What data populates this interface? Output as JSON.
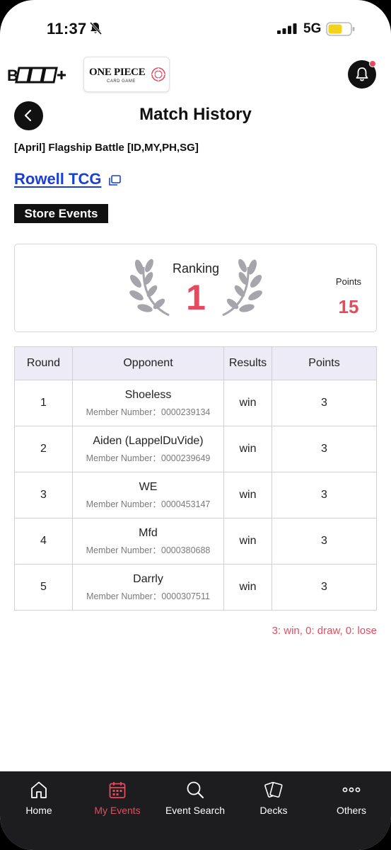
{
  "status_bar": {
    "time": "11:37",
    "network": "5G",
    "icons": [
      "bell-slash-icon",
      "signal-icon",
      "battery-icon"
    ]
  },
  "header": {
    "brand_logo_text": "B TCG+",
    "game_logo_title": "ONE PIECE",
    "game_logo_subtitle": "CARD GAME",
    "icons": [
      "notification-bell-icon"
    ]
  },
  "page": {
    "title": "Match History",
    "event_name": "[April] Flagship Battle [ID,MY,PH,SG]",
    "store_name": "Rowell TCG",
    "category": "Store Events"
  },
  "summary": {
    "ranking_label": "Ranking",
    "ranking_value": "1",
    "points_label": "Points",
    "points_value": "15"
  },
  "table": {
    "headers": [
      "Round",
      "Opponent",
      "Results",
      "Points"
    ],
    "rows": [
      {
        "round": "1",
        "opponent": "Shoeless",
        "member": "Member Number：0000239134",
        "result": "win",
        "points": "3"
      },
      {
        "round": "2",
        "opponent": "Aiden (LappelDuVide)",
        "member": "Member Number：0000239649",
        "result": "win",
        "points": "3"
      },
      {
        "round": "3",
        "opponent": "WE",
        "member": "Member Number：0000453147",
        "result": "win",
        "points": "3"
      },
      {
        "round": "4",
        "opponent": "Mfd",
        "member": "Member Number：0000380688",
        "result": "win",
        "points": "3"
      },
      {
        "round": "5",
        "opponent": "Darrly",
        "member": "Member Number：0000307511",
        "result": "win",
        "points": "3"
      }
    ]
  },
  "legend": "3: win, 0: draw, 0: lose",
  "bottom_nav": [
    {
      "label": "Home",
      "icon": "home-icon",
      "active": false
    },
    {
      "label": "My Events",
      "icon": "calendar-icon",
      "active": true
    },
    {
      "label": "Event Search",
      "icon": "search-icon",
      "active": false
    },
    {
      "label": "Decks",
      "icon": "cards-icon",
      "active": false
    },
    {
      "label": "Others",
      "icon": "more-icon",
      "active": false
    }
  ],
  "colors": {
    "accent": "#e54a5f",
    "link": "#1a3fd8",
    "dark": "#111111",
    "table_header_bg": "#ecebf6",
    "nav_bg": "#1d1d1f"
  }
}
